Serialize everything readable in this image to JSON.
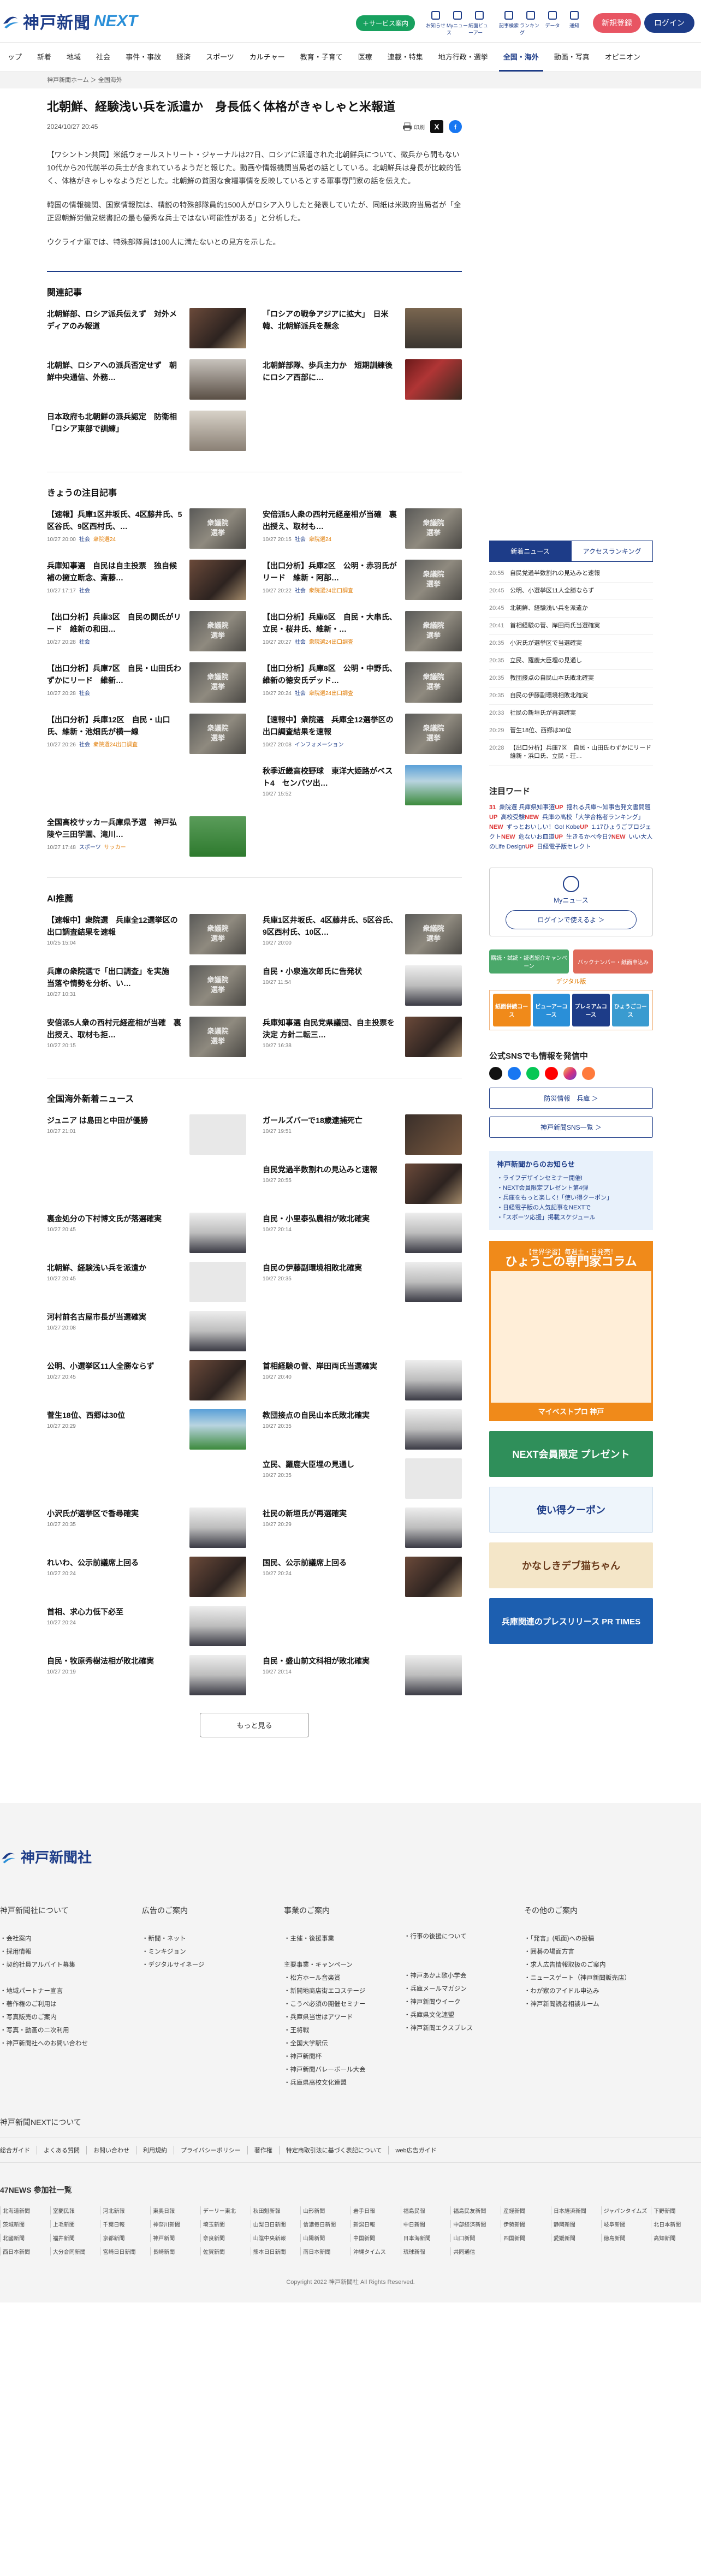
{
  "header": {
    "logo_main": "神戸新聞",
    "logo_next": "NEXT",
    "service_btn": "＋サービス案内",
    "icons": [
      {
        "name": "notice-icon",
        "label": "お知らせ"
      },
      {
        "name": "mynews-icon",
        "label": "Myニュース"
      },
      {
        "name": "paper-icon",
        "label": "紙面ビューアー"
      },
      {
        "name": "search-icon",
        "label": "記事検索"
      },
      {
        "name": "rank-icon",
        "label": "ランキング"
      },
      {
        "name": "data-icon",
        "label": "データ"
      },
      {
        "name": "bell-icon",
        "label": "通知"
      }
    ],
    "signup": "新規登録",
    "login": "ログイン"
  },
  "nav": [
    "ップ",
    "新着",
    "地域",
    "社会",
    "事件・事故",
    "経済",
    "スポーツ",
    "カルチャー",
    "教育・子育て",
    "医療",
    "連載・特集",
    "地方行政・選挙",
    "全国・海外",
    "動画・写真",
    "オピニオン"
  ],
  "nav_active": 12,
  "breadcrumb": "神戸新聞ホーム ＞ 全国海外",
  "article": {
    "title": "北朝鮮、経験浅い兵を派遣か　身長低く体格がきゃしゃと米報道",
    "date": "2024/10/27 20:45",
    "print": "印刷",
    "paras": [
      "【ワシントン共同】米紙ウォールストリート・ジャーナルは27日、ロシアに派遣された北朝鮮兵について、徴兵から間もない10代から20代前半の兵士が含まれているようだと報じた。動画や情報機関当局者の話としている。北朝鮮兵は身長が比較的低く、体格がきゃしゃなようだとした。北朝鮮の貧困な食糧事情を反映しているとする軍事専門家の話を伝えた。",
      "韓国の情報機関、国家情報院は、精鋭の特殊部隊員約1500人がロシア入りしたと発表していたが、同紙は米政府当局者が「全正恩朝鮮労働党総書記の最も優秀な兵士ではない可能性がある」と分析した。",
      "ウクライナ軍では、特殊部隊員は100人に満たないとの見方を示した。"
    ]
  },
  "related": {
    "title": "関連記事",
    "items": [
      {
        "t": "北朝鮮部、ロシア派兵伝えず　対外メディアのみ報道",
        "th": "th-photo"
      },
      {
        "t": "「ロシアの戦争アジアに拡大」　日米韓、北朝鮮派兵を懸念",
        "th": "th-face"
      },
      {
        "t": "北朝鮮、ロシアへの派兵否定せず　朝鮮中央通信、外務…",
        "th": "th-kim"
      },
      {
        "t": "北朝鮮部隊、歩兵主力か　短期訓練後にロシア西部に…",
        "th": "th-flag"
      },
      {
        "t": "日本政府も北朝鮮の派兵認定　防衛相「ロシア東部で訓練」",
        "th": "th-man"
      }
    ]
  },
  "featured": {
    "title": "きょうの注目記事",
    "items": [
      {
        "t": "【速報】兵庫1区井坂氏、4区藤井氏、5区谷氏、9区西村氏、…",
        "d": "10/27 20:00",
        "c": "社会",
        "tag": "衆院選24",
        "th": "th-elec"
      },
      {
        "t": "安倍派5人衆の西村元経産相が当確　裏出授え、取材も…",
        "d": "10/27 20:15",
        "c": "社会",
        "tag": "衆院選24",
        "th": "th-elec"
      },
      {
        "t": "兵庫知事選　自民は自主投票　独自候補の擁立断念、斎藤…",
        "d": "10/27 17:17",
        "c": "社会",
        "tag": "",
        "th": "th-photo"
      },
      {
        "t": "【出口分析】兵庫2区　公明・赤羽氏がリード　維新・阿部…",
        "d": "10/27 20:22",
        "c": "社会",
        "tag": "衆院選24出口調査",
        "th": "th-elec"
      },
      {
        "t": "【出口分析】兵庫3区　自民の関氏がリード　維新の和田…",
        "d": "10/27 20:28",
        "c": "社会",
        "tag": "",
        "th": "th-elec"
      },
      {
        "t": "【出口分析】兵庫6区　自民・大串氏、立民・桜井氏、維新・…",
        "d": "10/27 20:27",
        "c": "社会",
        "tag": "衆院選24出口調査",
        "th": "th-elec"
      },
      {
        "t": "【出口分析】兵庫7区　自民・山田氏わずかにリード　維新…",
        "d": "10/27 20:28",
        "c": "社会",
        "tag": "",
        "th": "th-elec"
      },
      {
        "t": "【出口分析】兵庫8区　公明・中野氏、維新の徳安氏デッド…",
        "d": "10/27 20:24",
        "c": "社会",
        "tag": "衆院選24出口調査",
        "th": "th-elec"
      },
      {
        "t": "【出口分析】兵庫12区　自民・山口氏、維新・池畑氏が横一線",
        "d": "10/27 20:26",
        "c": "社会",
        "tag": "衆院選24出口調査",
        "th": "th-elec"
      },
      {
        "t": "【速報中】衆院選　兵庫全12選挙区の出口調査結果を速報",
        "d": "10/27 20:08",
        "c": "インフォメーション",
        "tag": "",
        "th": "th-elec"
      },
      {
        "t": "",
        "d": "",
        "c": "",
        "tag": "",
        "th": ""
      },
      {
        "t": "秋季近畿高校野球　東洋大姫路がベスト4　センバツ出…",
        "d": "10/27 15:52",
        "c": "",
        "tag": "",
        "th": "th-sport"
      },
      {
        "t": "全国高校サッカー兵庫県予選　神戸弘陵や三田学園、滝川…",
        "d": "10/27 17:48",
        "c": "スポーツ",
        "tag": "サッカー",
        "th": "th-soccer"
      }
    ]
  },
  "ai": {
    "title": "AI推薦",
    "items": [
      {
        "t": "【速報中】衆院選　兵庫全12選挙区の出口調査結果を速報",
        "d": "10/25 15:04",
        "th": "th-elec"
      },
      {
        "t": "兵庫1区井坂氏、4区藤井氏、5区谷氏、9区西村氏、10区…",
        "d": "10/27 20:00",
        "th": "th-elec"
      },
      {
        "t": "兵庫の衆院選で「出口調査」を実施　当落や情勢を分析、い…",
        "d": "10/27 10:31",
        "th": "th-elec"
      },
      {
        "t": "自民・小泉進次郎氏に告発状",
        "d": "10/27 11:54",
        "th": "th-portrait"
      },
      {
        "t": "安倍派5人衆の西村元経産相が当確　裏出授え、取材も拒…",
        "d": "10/27 20:15",
        "th": "th-elec"
      },
      {
        "t": "兵庫知事選 自民党県議団、自主投票を決定 方針二転三…",
        "d": "10/27 16:38",
        "th": "th-photo"
      }
    ]
  },
  "national": {
    "title": "全国海外新着ニュース",
    "items": [
      {
        "t": "ジュニア は島田と中田が優勝",
        "d": "10/27 21:01",
        "th": "th-gray"
      },
      {
        "t": "ガールズバーで18歳逮捕死亡",
        "d": "10/27 19:51",
        "th": "th-dark"
      },
      {
        "t": "",
        "d": "",
        "th": ""
      },
      {
        "t": "自民党過半数割れの見込みと速報",
        "d": "10/27 20:55",
        "th": "th-photo"
      },
      {
        "t": "裏金処分の下村博文氏が落選確実",
        "d": "10/27 20:45",
        "th": "th-portrait"
      },
      {
        "t": "自民・小里泰弘農相が敗北確実",
        "d": "10/27 20:14",
        "th": "th-portrait"
      },
      {
        "t": "北朝鮮、経験浅い兵を派遣か",
        "d": "10/27 20:45",
        "th": "th-gray"
      },
      {
        "t": "自民の伊藤副環境相敗北確実",
        "d": "10/27 20:35",
        "th": "th-portrait"
      },
      {
        "t": "河村前名古屋市長が当選確実",
        "d": "10/27 20:08",
        "th": "th-portrait"
      },
      {
        "t": "",
        "d": "",
        "th": ""
      },
      {
        "t": "公明、小選挙区11人全勝ならず",
        "d": "10/27 20:45",
        "th": "th-photo"
      },
      {
        "t": "首相経験の菅、岸田両氏当選確実",
        "d": "10/27 20:40",
        "th": "th-portrait"
      },
      {
        "t": "菅生18位、西郷は30位",
        "d": "10/27 20:29",
        "th": "th-sport"
      },
      {
        "t": "教団接点の自民山本氏敗北確実",
        "d": "10/27 20:35",
        "th": "th-portrait"
      },
      {
        "t": "",
        "d": "",
        "th": ""
      },
      {
        "t": "立民、羅鹿大臣埋の見通し",
        "d": "10/27 20:35",
        "th": "th-gray"
      },
      {
        "t": "小沢氏が選挙区で香尋確実",
        "d": "10/27 20:35",
        "th": "th-portrait"
      },
      {
        "t": "社民の新垣氏が再選確実",
        "d": "10/27 20:29",
        "th": "th-portrait"
      },
      {
        "t": "れいわ、公示前議席上回る",
        "d": "10/27 20:24",
        "th": "th-photo"
      },
      {
        "t": "国民、公示前議席上回る",
        "d": "10/27 20:24",
        "th": "th-photo"
      },
      {
        "t": "首相、求心力低下必至",
        "d": "10/27 20:24",
        "th": "th-portrait"
      },
      {
        "t": "",
        "d": "",
        "th": ""
      },
      {
        "t": "自民・牧原秀樹法相が敗北確実",
        "d": "10/27 20:19",
        "th": "th-portrait"
      },
      {
        "t": "自民・盛山前文科相が敗北確実",
        "d": "10/27 20:14",
        "th": "th-portrait"
      }
    ]
  },
  "more": "もっと見る",
  "side": {
    "tab_on": "新着ニュース",
    "tab_off": "アクセスランキング",
    "news": [
      {
        "t": "20:55",
        "s": "自民党過半数割れの見込みと速報"
      },
      {
        "t": "20:45",
        "s": "公明、小選挙区11人全勝ならず"
      },
      {
        "t": "20:45",
        "s": "北朝鮮、経験浅い兵を派遣か"
      },
      {
        "t": "20:41",
        "s": "首相経験の菅、岸田両氏当選確実"
      },
      {
        "t": "20:35",
        "s": "小沢氏が選挙区で当選確実"
      },
      {
        "t": "20:35",
        "s": "立民、羅鹿大臣埋の見通し"
      },
      {
        "t": "20:35",
        "s": "教団接点の自民山本氏敗北確実"
      },
      {
        "t": "20:35",
        "s": "自民の伊藤副環境相敗北確実"
      },
      {
        "t": "20:33",
        "s": "社民の新垣氏が再選確実"
      },
      {
        "t": "20:29",
        "s": "菅生18位、西郷は30位"
      },
      {
        "t": "20:28",
        "s": "【出口分析】兵庫7区　自民・山田氏わずかにリード　維新・浜口氏、立民・荘…"
      }
    ],
    "kw_title": "注目ワード",
    "kws": [
      {
        "st": "31",
        "cls": "n",
        "w": "衆院選 兵庫県知事選"
      },
      {
        "st": "UP",
        "cls": "up",
        "w": "揺れる兵庫～知事告発文書問題"
      },
      {
        "st": "UP",
        "cls": "up",
        "w": "高校受験"
      },
      {
        "st": "NEW",
        "cls": "new",
        "w": "兵庫の高校「大学合格者ランキング」"
      },
      {
        "st": "NEW",
        "cls": "new",
        "w": "ずっとおいしい！Go! Kobe"
      },
      {
        "st": "UP",
        "cls": "up",
        "w": "1.17ひょうごプロジェクト"
      },
      {
        "st": "NEW",
        "cls": "new",
        "w": "危ないお皿道"
      },
      {
        "st": "UP",
        "cls": "up",
        "w": "生きるかベ今日?"
      },
      {
        "st": "NEW",
        "cls": "new",
        "w": "いい大人のLife Design"
      },
      {
        "st": "UP",
        "cls": "up",
        "w": "日経電子版セレクト"
      }
    ],
    "mynews_label": "Myニュース",
    "mynews_btn": "ログインで使えるよ ＞",
    "promo": [
      "購読・試読・読者紹介キャンペーン",
      "バックナンバー・紙面申込み"
    ],
    "digital": "デジタル版",
    "dg": [
      "紙面併読コース",
      "ビューアーコース",
      "プレミアムコース",
      "ひょうごコース"
    ],
    "sns_title": "公式SNSでも情報を発信中",
    "pill1": "防災情報　兵庫 ＞",
    "pill2": "神戸新聞SNS一覧 ＞",
    "notice_title": "神戸新聞からのお知らせ",
    "notices": [
      "・ライフデザインセミナー開催!",
      "・NEXT会員限定プレゼント第4弾",
      "・兵庫をもっと楽しく!「使い得クーポン」",
      "・日経電子版の人気記事をNEXTで",
      "・「スポーツ応援」掲載スケジュール"
    ],
    "job_top": "【世界学習】毎週土・日発売！",
    "job_big": "ひょうごの専門家コラム",
    "job_foot": "マイベストプロ 神戸",
    "ban1": "NEXT会員限定 プレゼント",
    "ban2": "使い得クーポン",
    "ban3": "かなしきデブ猫ちゃん",
    "ban4": "兵庫関連のプレスリリース PR TIMES"
  },
  "footer": {
    "logo": "神戸新聞社",
    "cols": [
      {
        "h": "神戸新聞社について",
        "items": [
          "・会社案内",
          "・採用情報",
          "・契約社員アルバイト募集",
          "",
          "・地域パートナー宣言",
          "・著作権のご利用は",
          "・写真販売のご案内",
          "・写真・動画の二次利用",
          "・神戸新聞社へのお問い合わせ"
        ]
      },
      {
        "h": "広告のご案内",
        "items": [
          "・新聞・ネット",
          "・ミンキジョン",
          "・デジタルサイネージ"
        ]
      },
      {
        "h": "事業のご案内",
        "items": [
          "・主催・後援事業",
          "",
          "主要事業・キャンペーン",
          "・松方ホール音楽賞",
          "・新開地商店街エコステージ",
          "・こうべ必須の開催セミナー",
          "・兵庫県当世はアワード",
          "・王将戦",
          "・全国大学駅伝",
          "・神戸新聞杯",
          "・神戸新聞バレーボール大会",
          "・兵庫県高校文化連盟"
        ]
      },
      {
        "h": "",
        "items": [
          "・行事の後援について",
          "",
          "",
          "・神戸あかよ歌小学会",
          "・兵庫メールマガジン",
          "・神戸新聞ウイーク",
          "・兵庫県文化連盟",
          "・神戸新聞エクスプレス"
        ]
      },
      {
        "h": "その他のご案内",
        "items": [
          "・「発言」(紙面)への投稿",
          "・囲碁の場面方言",
          "・求人広告情報取扱のご案内",
          "・ニュースゲート（神戸新聞販売店）",
          "・わが家のアイドル申込み",
          "・神戸新聞読者相談ルーム"
        ]
      }
    ],
    "next_title": "神戸新聞NEXTについて",
    "links": [
      "総合ガイド",
      "よくある質問",
      "お問い合わせ",
      "利用規約",
      "プライバシーポリシー",
      "著作権",
      "特定商取引法に基づく表記について",
      "web広告ガイド"
    ],
    "n47": "47NEWS 参加社一覧",
    "papers": [
      "北海道新聞",
      "室蘭民報",
      "河北新報",
      "東奥日報",
      "デーリー東北",
      "秋田魁新報",
      "山形新聞",
      "岩手日報",
      "福島民報",
      "福島民友新聞",
      "産経新聞",
      "日本経済新聞",
      "ジャパンタイムズ",
      "下野新聞",
      "茨城新聞",
      "上毛新聞",
      "千葉日報",
      "神奈川新聞",
      "埼玉新聞",
      "山梨日日新聞",
      "信濃毎日新聞",
      "新潟日報",
      "中日新聞",
      "中部経済新聞",
      "伊勢新聞",
      "静岡新聞",
      "岐阜新聞",
      "北日本新聞",
      "北國新聞",
      "福井新聞",
      "京都新聞",
      "神戸新聞",
      "奈良新聞",
      "山陰中央新報",
      "山陽新聞",
      "中国新聞",
      "日本海新聞",
      "山口新聞",
      "四国新聞",
      "愛媛新聞",
      "徳島新聞",
      "高知新聞",
      "西日本新聞",
      "大分合同新聞",
      "宮崎日日新聞",
      "長崎新聞",
      "佐賀新聞",
      "熊本日日新聞",
      "南日本新聞",
      "沖縄タイムス",
      "琉球新報",
      "共同通信"
    ],
    "copy": "Copyright 2022 神戸新聞社 All Rights Reserved."
  }
}
